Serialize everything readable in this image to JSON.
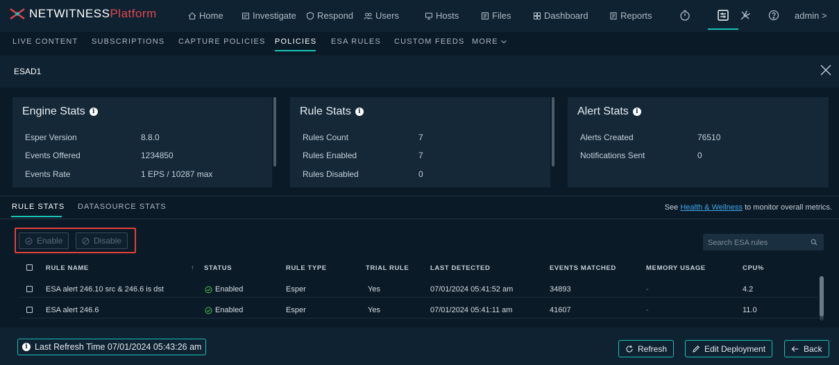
{
  "brand": {
    "name": "NETWITNESS",
    "suffix": "Platform",
    "accent": "#19c3b7",
    "logo_color": "#e0484b"
  },
  "nav": [
    {
      "label": "Home",
      "icon": "home-icon"
    },
    {
      "label": "Investigate",
      "icon": "investigate-icon"
    },
    {
      "label": "Respond",
      "icon": "respond-icon"
    },
    {
      "label": "Users",
      "icon": "users-icon"
    },
    {
      "label": "Hosts",
      "icon": "hosts-icon"
    },
    {
      "label": "Files",
      "icon": "files-icon"
    },
    {
      "label": "Dashboard",
      "icon": "dashboard-icon"
    },
    {
      "label": "Reports",
      "icon": "reports-icon"
    }
  ],
  "user": {
    "label": "admin >"
  },
  "tabs": [
    {
      "label": "LIVE CONTENT"
    },
    {
      "label": "SUBSCRIPTIONS"
    },
    {
      "label": "CAPTURE POLICIES"
    },
    {
      "label": "POLICIES",
      "active": true
    },
    {
      "label": "ESA RULES"
    },
    {
      "label": "CUSTOM FEEDS"
    },
    {
      "label": "MORE"
    }
  ],
  "service": {
    "name": "ESAD1"
  },
  "engine_stats": {
    "title": "Engine Stats",
    "rows": [
      {
        "label": "Esper Version",
        "value": "8.8.0"
      },
      {
        "label": "Events Offered",
        "value": "1234850"
      },
      {
        "label": "Events Rate",
        "value": "1 EPS / 10287 max"
      }
    ]
  },
  "rule_stats": {
    "title": "Rule Stats",
    "rows": [
      {
        "label": "Rules Count",
        "value": "7"
      },
      {
        "label": "Rules Enabled",
        "value": "7"
      },
      {
        "label": "Rules Disabled",
        "value": "0"
      }
    ]
  },
  "alert_stats": {
    "title": "Alert Stats",
    "rows": [
      {
        "label": "Alerts Created",
        "value": "76510"
      },
      {
        "label": "Notifications Sent",
        "value": "0"
      }
    ]
  },
  "section_tabs": [
    {
      "label": "RULE STATS",
      "active": true
    },
    {
      "label": "DATASOURCE STATS"
    }
  ],
  "health": {
    "prefix": "See",
    "link": "Health & Wellness",
    "suffix": "to monitor overall metrics."
  },
  "actions": {
    "enable": "Enable",
    "disable": "Disable"
  },
  "search": {
    "placeholder": "Search ESA rules"
  },
  "table": {
    "headers": [
      "RULE NAME",
      "STATUS",
      "RULE TYPE",
      "TRIAL RULE",
      "LAST DETECTED",
      "EVENTS MATCHED",
      "MEMORY USAGE",
      "CPU%"
    ],
    "rows": [
      {
        "name": "ESA alert 246.10 src & 246.6 is dst",
        "status": "Enabled",
        "type": "Esper",
        "trial": "Yes",
        "last_detected": "07/01/2024 05:41:52 am",
        "events_matched": "34893",
        "memory": "-",
        "cpu": "4.2"
      },
      {
        "name": "ESA alert 246.6",
        "status": "Enabled",
        "type": "Esper",
        "trial": "Yes",
        "last_detected": "07/01/2024 05:41:11 am",
        "events_matched": "41607",
        "memory": "-",
        "cpu": "11.0"
      }
    ]
  },
  "footer": {
    "last_refresh": "Last Refresh Time 07/01/2024 05:43:26 am",
    "refresh": "Refresh",
    "edit_deployment": "Edit Deployment",
    "back": "Back"
  }
}
